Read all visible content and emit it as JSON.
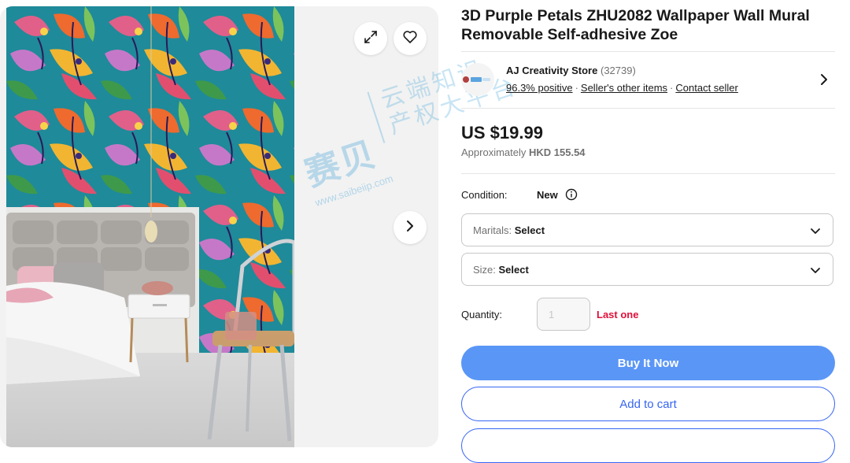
{
  "item": {
    "title": "3D Purple Petals ZHU2082 Wallpaper Wall Mural Removable Self-adhesive Zoe"
  },
  "seller": {
    "name": "AJ Creativity Store",
    "feedback_count": "(32739)",
    "positive": "96.3% positive",
    "other_items": "Seller's other items",
    "contact": "Contact seller"
  },
  "price": {
    "main": "US $19.99",
    "approx_prefix": "Approximately ",
    "approx_value": "HKD 155.54"
  },
  "condition": {
    "label": "Condition:",
    "value": "New"
  },
  "selects": {
    "maritals": {
      "label": "Maritals: ",
      "value": "Select"
    },
    "size": {
      "label": "Size: ",
      "value": "Select"
    }
  },
  "quantity": {
    "label": "Quantity:",
    "placeholder": "1",
    "stock_note": "Last one"
  },
  "buttons": {
    "buy_now": "Buy It Now",
    "add_to_cart": "Add to cart"
  },
  "watermark": {
    "brand_cn": "赛贝",
    "line1_cn": "云端知识",
    "line2_cn": "产权大平台",
    "url": "www.saibeiip.com"
  },
  "colors": {
    "buy_button": "#5a96f6",
    "accent_blue": "#3665f3",
    "stock_red": "#e0103a",
    "text_muted": "#707070"
  },
  "icons": {
    "expand": "expand-icon",
    "favorite": "heart-icon",
    "next_image": "chevron-right-icon",
    "seller_nav": "chevron-right-icon",
    "condition_info": "info-icon",
    "dropdown": "chevron-down-icon"
  }
}
